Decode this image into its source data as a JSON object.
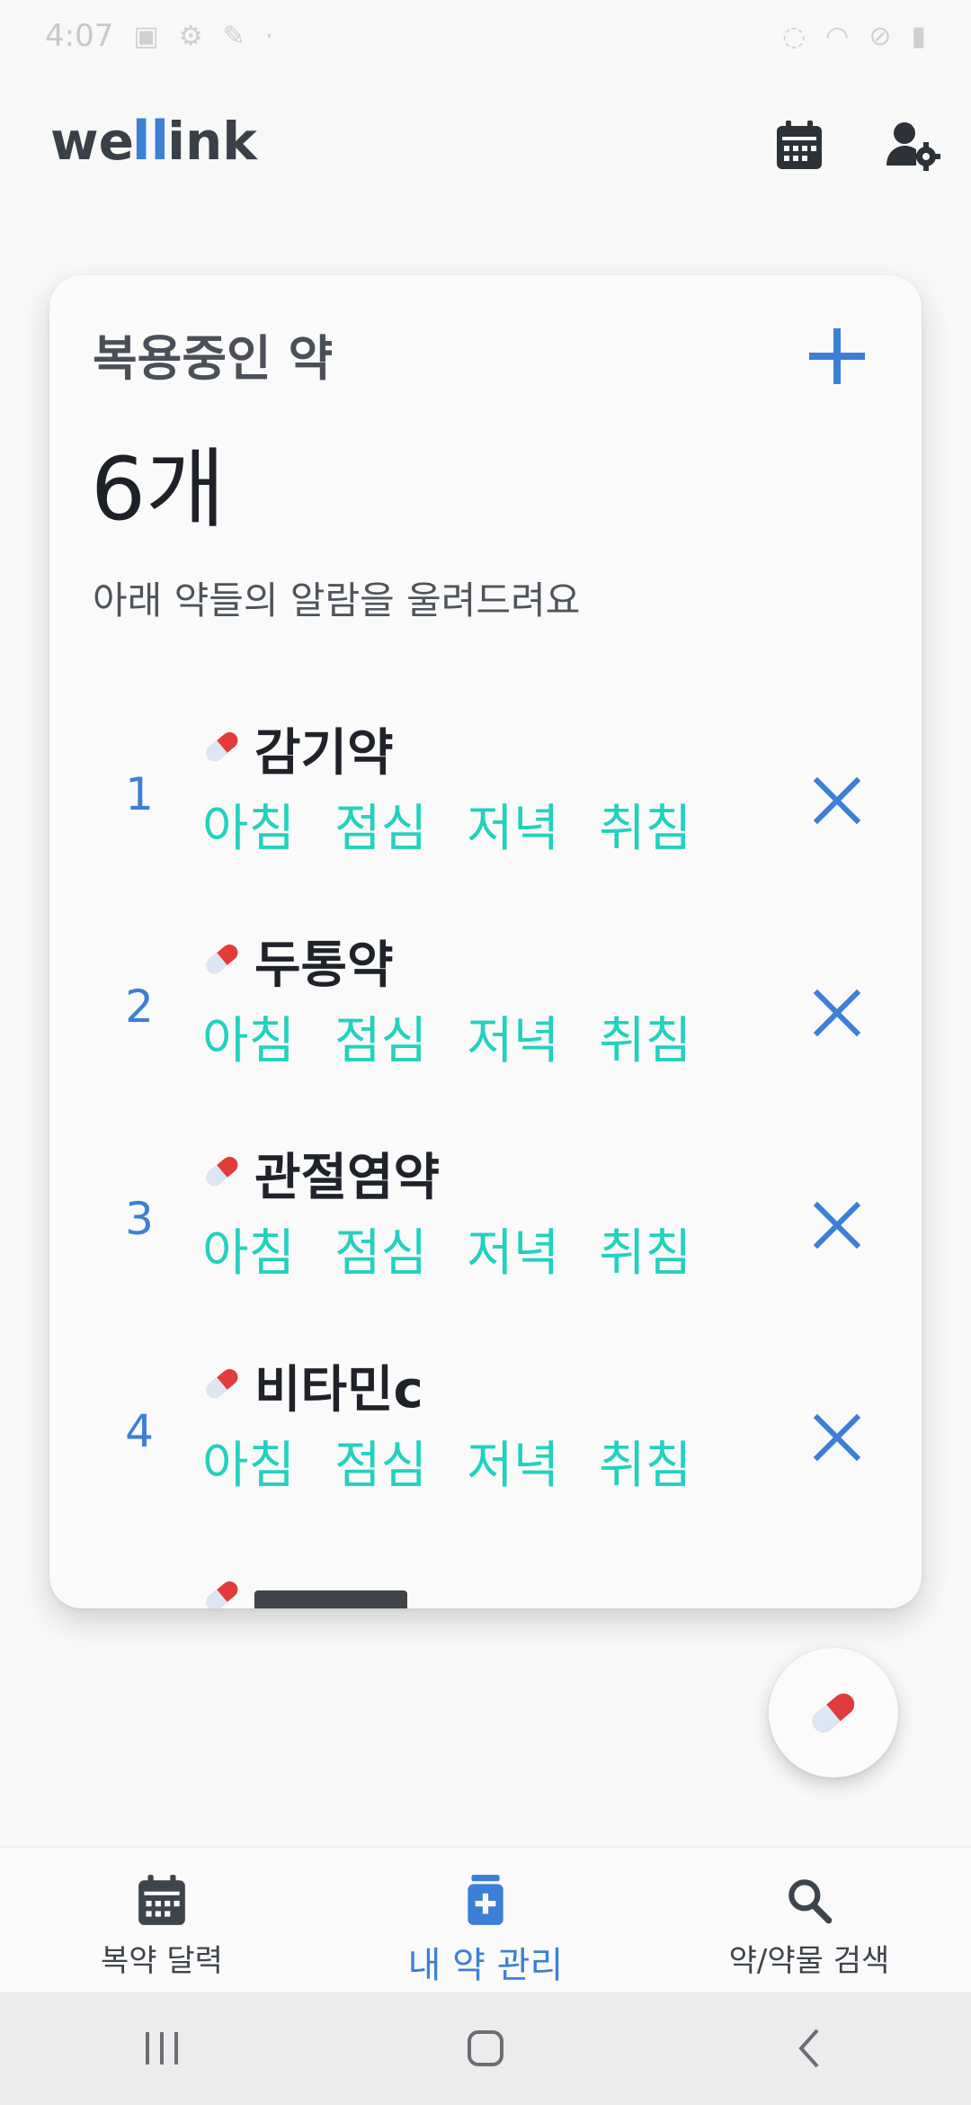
{
  "status_bar": {
    "time": "4:07"
  },
  "header": {
    "logo_left": "we",
    "logo_mid": "ll",
    "logo_right": "ink"
  },
  "card": {
    "title": "복용중인 약",
    "count": "6개",
    "subtitle": "아래 약들의 알람을 울려드려요",
    "medications": [
      {
        "number": "1",
        "name": "감기약",
        "times": [
          "아침",
          "점심",
          "저녁",
          "취침"
        ]
      },
      {
        "number": "2",
        "name": "두통약",
        "times": [
          "아침",
          "점심",
          "저녁",
          "취침"
        ]
      },
      {
        "number": "3",
        "name": "관절염약",
        "times": [
          "아침",
          "점심",
          "저녁",
          "취침"
        ]
      },
      {
        "number": "4",
        "name": "비타민c",
        "times": [
          "아침",
          "점심",
          "저녁",
          "취침"
        ]
      }
    ]
  },
  "bottom_nav": {
    "items": [
      {
        "label": "복약 달력",
        "icon": "calendar-icon",
        "active": false
      },
      {
        "label": "내 약 관리",
        "icon": "medicine-bottle-icon",
        "active": true
      },
      {
        "label": "약/약물 검색",
        "icon": "search-icon",
        "active": false
      }
    ]
  },
  "colors": {
    "accent_blue": "#3c7fd6",
    "time_teal": "#22d1be",
    "pill_red": "#e23b3b"
  }
}
